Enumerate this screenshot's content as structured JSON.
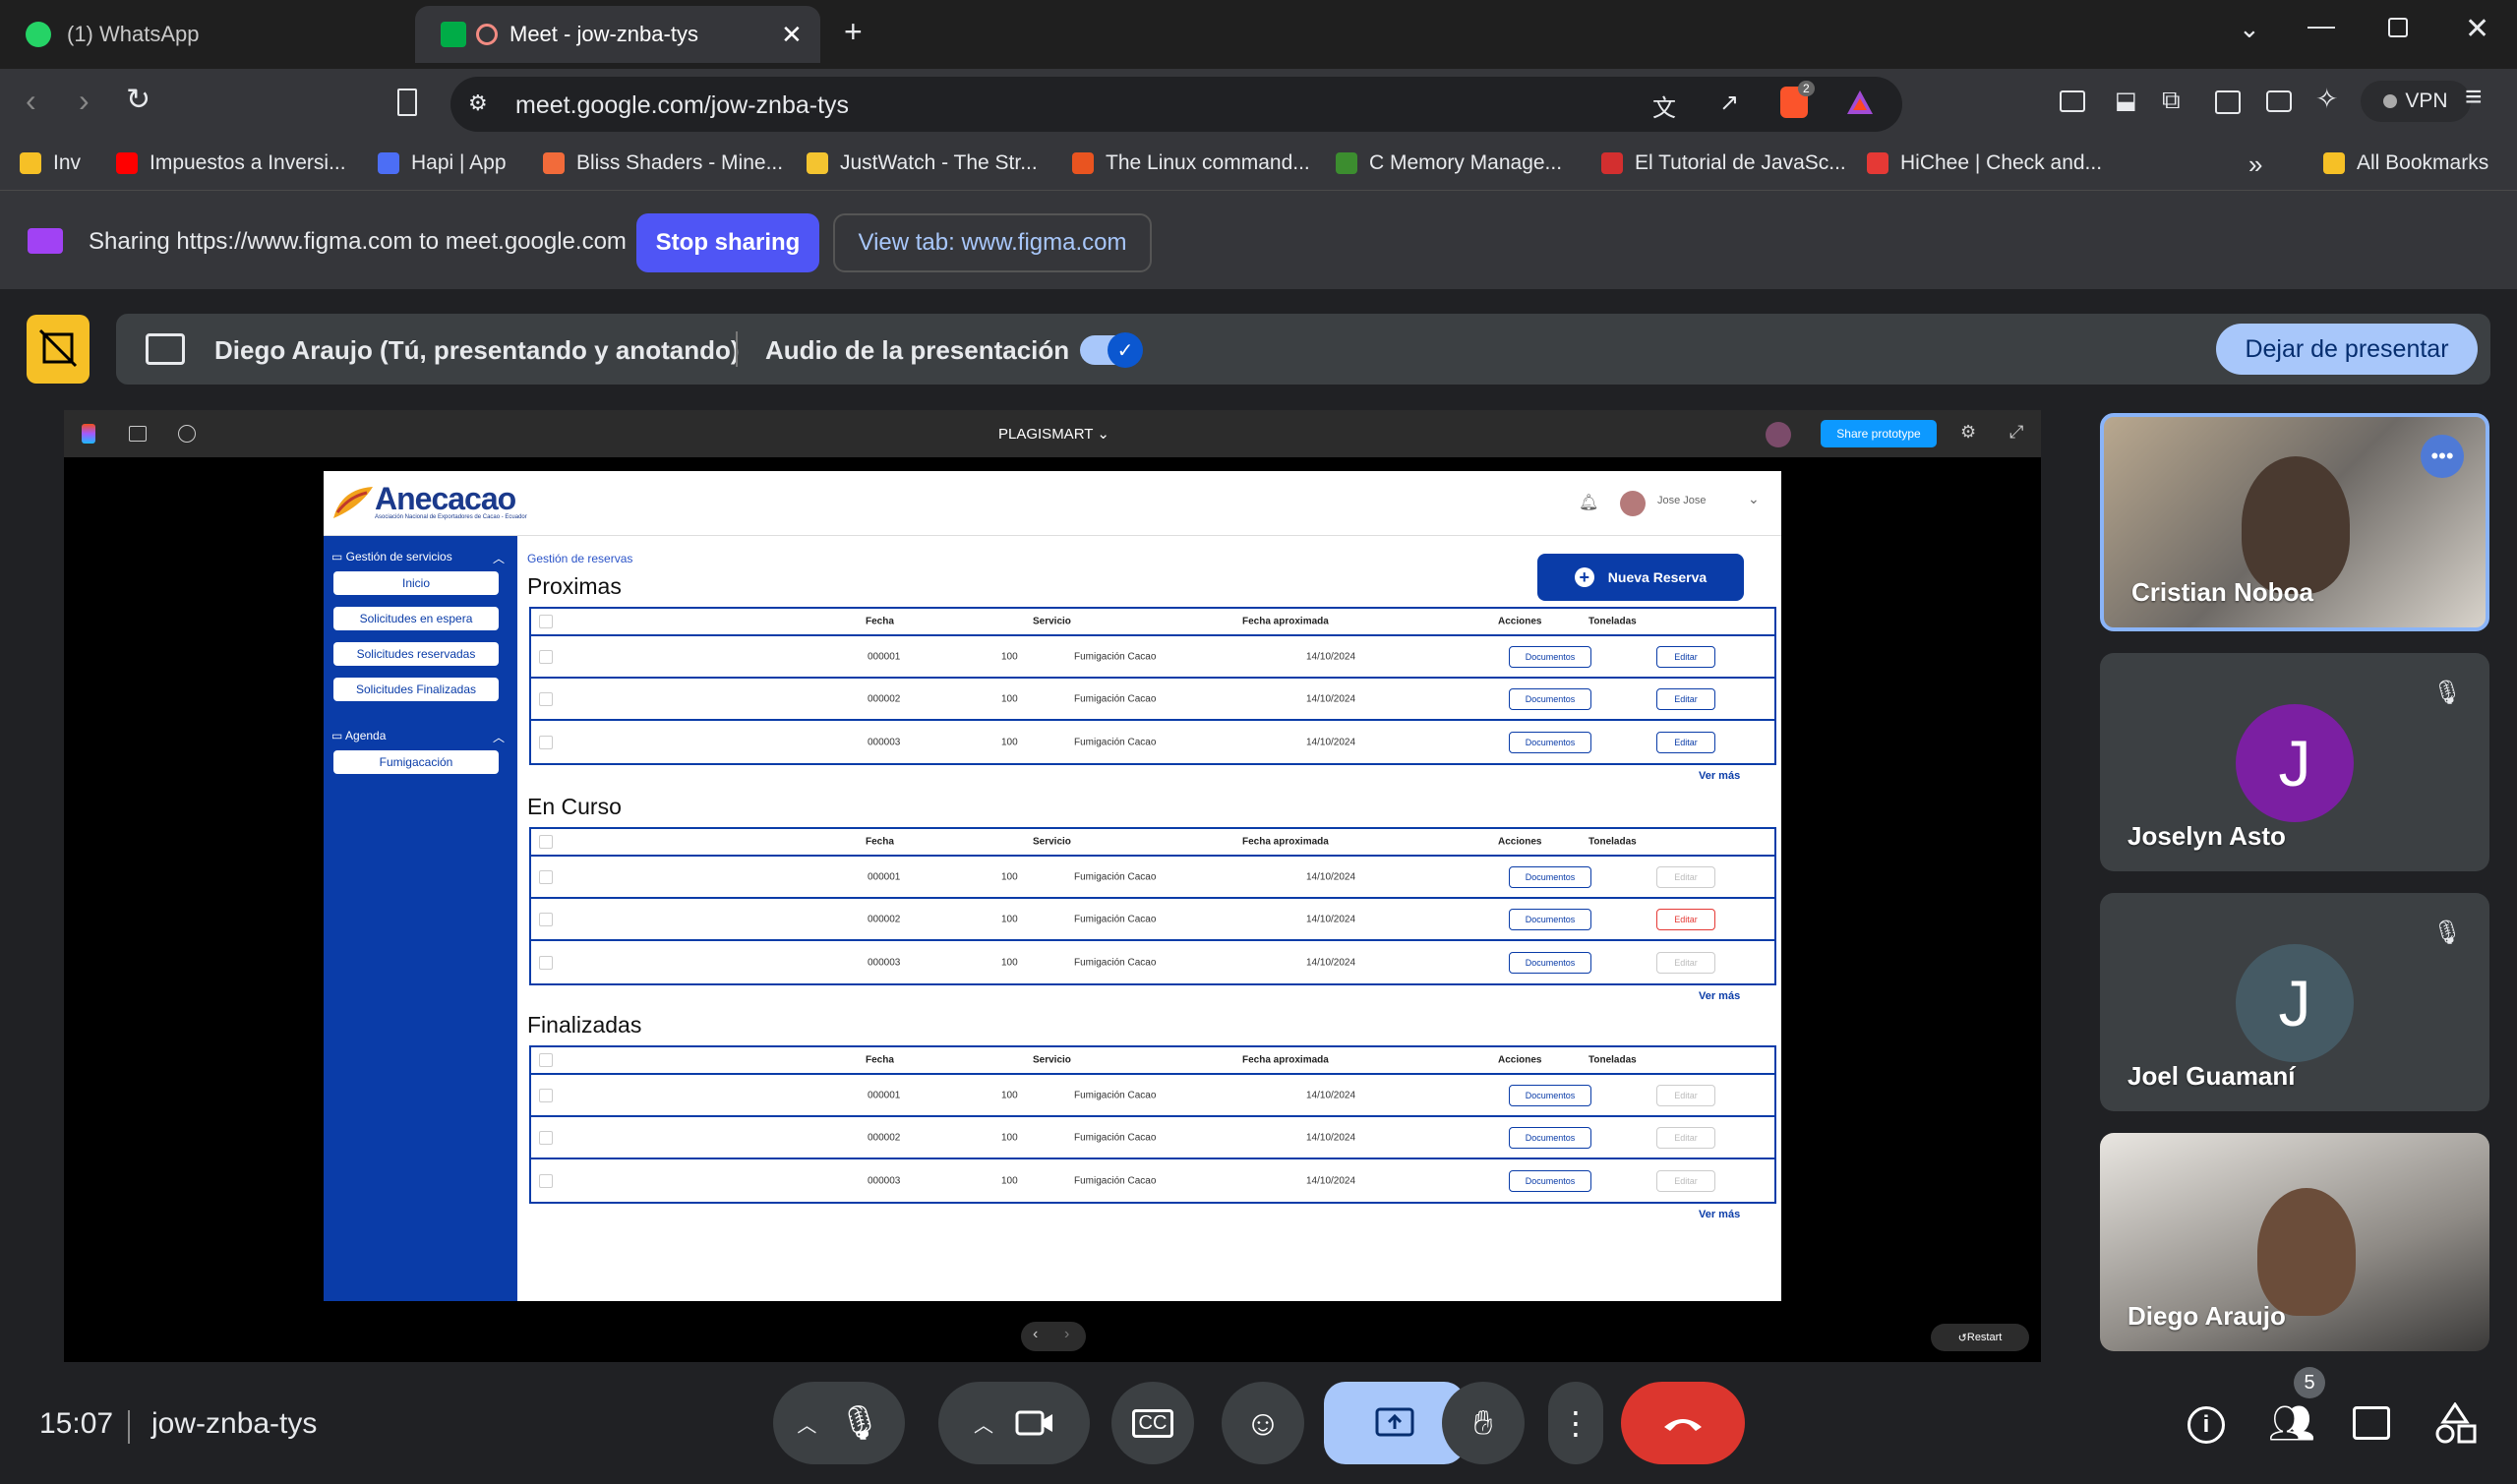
{
  "browser": {
    "tabs": [
      {
        "title": "(1) WhatsApp"
      },
      {
        "title": "Meet - jow-znba-tys"
      }
    ],
    "url": "meet.google.com/jow-znba-tys",
    "vpn_label": "VPN",
    "brave_badge": "2",
    "bookmarks": [
      "Inv",
      "Impuestos a Inversi...",
      "Hapi | App",
      "Bliss Shaders - Mine...",
      "JustWatch - The Str...",
      "The Linux command...",
      "C Memory Manage...",
      "El Tutorial de JavaSc...",
      "HiChee | Check and..."
    ],
    "all_bookmarks": "All Bookmarks"
  },
  "sharing": {
    "text": "Sharing https://www.figma.com to meet.google.com",
    "stop_label": "Stop sharing",
    "view_tab_label": "View tab: www.figma.com"
  },
  "meet": {
    "presenter": "Diego Araujo (Tú, presentando y anotando)",
    "audio_label": "Audio de la presentación",
    "stop_present_label": "Dejar de presentar",
    "time": "15:07",
    "code": "jow-znba-tys",
    "participant_count": "5",
    "participants": [
      {
        "name": "Cristian Noboa"
      },
      {
        "name": "Joselyn Asto",
        "initial": "J",
        "color": "#7b1fa2"
      },
      {
        "name": "Joel Guamaní",
        "initial": "J",
        "color": "#455a64"
      },
      {
        "name": "Diego Araujo"
      }
    ]
  },
  "figma": {
    "file_name": "PLAGISMART",
    "share_label": "Share prototype",
    "restart_label": "Restart"
  },
  "app": {
    "logo": "Anecacao",
    "logo_sub": "Asociación Nacional de Exportadores de Cacao - Ecuador",
    "user": "Jose Jose",
    "sidebar": {
      "section1": "Gestión de servicios",
      "items1": [
        "Inicio",
        "Solicitudes en espera",
        "Solicitudes reservadas",
        "Solicitudes Finalizadas"
      ],
      "section2": "Agenda",
      "items2": [
        "Fumigacación"
      ]
    },
    "breadcrumb": "Gestión de reservas",
    "new_button": "Nueva Reserva",
    "columns": [
      "Fecha",
      "Servicio",
      "Fecha aproximada",
      "Toneladas",
      "Acciones"
    ],
    "doc_label": "Documentos",
    "edit_label": "Editar",
    "ver_mas": "Ver más",
    "sections": [
      {
        "title": "Proximas",
        "rows": [
          {
            "id": "000001",
            "service": "Fumigación Cacao",
            "date": "14/10/2024",
            "tons": "100"
          },
          {
            "id": "000002",
            "service": "Fumigación Cacao",
            "date": "14/10/2024",
            "tons": "100"
          },
          {
            "id": "000003",
            "service": "Fumigación Cacao",
            "date": "14/10/2024",
            "tons": "100"
          }
        ]
      },
      {
        "title": "En Curso",
        "rows": [
          {
            "id": "000001",
            "service": "Fumigación Cacao",
            "date": "14/10/2024",
            "tons": "100"
          },
          {
            "id": "000002",
            "service": "Fumigación Cacao",
            "date": "14/10/2024",
            "tons": "100"
          },
          {
            "id": "000003",
            "service": "Fumigación Cacao",
            "date": "14/10/2024",
            "tons": "100"
          }
        ]
      },
      {
        "title": "Finalizadas",
        "rows": [
          {
            "id": "000001",
            "service": "Fumigación Cacao",
            "date": "14/10/2024",
            "tons": "100"
          },
          {
            "id": "000002",
            "service": "Fumigación Cacao",
            "date": "14/10/2024",
            "tons": "100"
          },
          {
            "id": "000003",
            "service": "Fumigación Cacao",
            "date": "14/10/2024",
            "tons": "100"
          }
        ]
      }
    ]
  }
}
